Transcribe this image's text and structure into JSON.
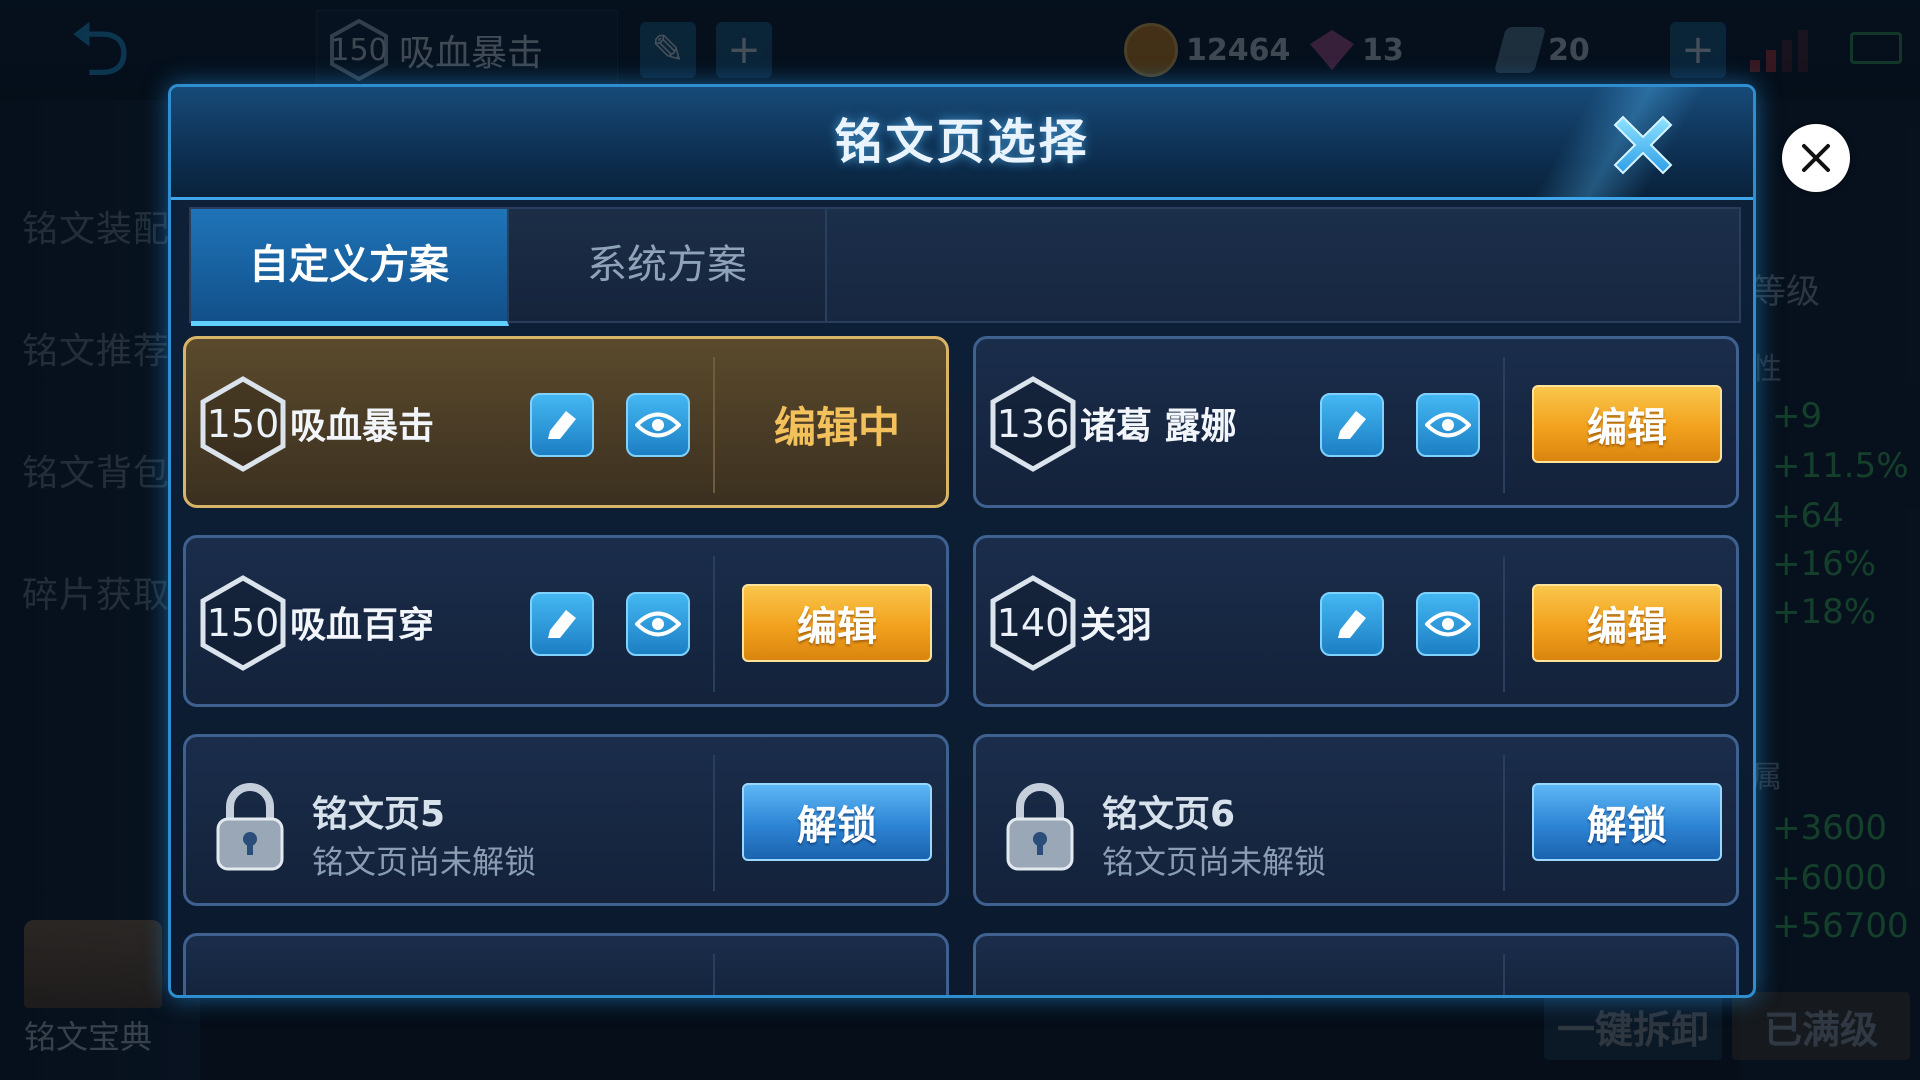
{
  "top_bar": {
    "back_icon": "back-arrow-icon",
    "current_page_level": "150",
    "current_page_name": "吸血暴击",
    "gold": "12464",
    "diamonds": "13",
    "tickets": "20"
  },
  "left_menu": {
    "items": [
      "铭文装配",
      "铭文推荐",
      "铭文背包",
      "碎片获取"
    ],
    "book_label": "铭文宝典"
  },
  "right_panel": {
    "level_label": "等级",
    "attr_label": "性",
    "stats": [
      "+9",
      "+11.5%",
      "+64",
      "+16%",
      "+18%"
    ],
    "belong_label": "属",
    "totals": [
      "+3600",
      "+6000",
      "+56700"
    ],
    "dismantle_all": "一键拆卸",
    "maxed": "已满级"
  },
  "dialog": {
    "title": "铭文页选择",
    "tabs": [
      {
        "label": "自定义方案",
        "active": true
      },
      {
        "label": "系统方案",
        "active": false
      }
    ],
    "pages": [
      {
        "level": "150",
        "name": "吸血暴击",
        "status": "编辑中",
        "selected": true
      },
      {
        "level": "136",
        "name": "诸葛 露娜",
        "action": "编辑"
      },
      {
        "level": "150",
        "name": "吸血百穿",
        "action": "编辑"
      },
      {
        "level": "140",
        "name": "关羽",
        "action": "编辑"
      },
      {
        "name": "铭文页5",
        "subtitle": "铭文页尚未解锁",
        "action": "解锁",
        "locked": true
      },
      {
        "name": "铭文页6",
        "subtitle": "铭文页尚未解锁",
        "action": "解锁",
        "locked": true
      }
    ]
  },
  "colors": {
    "accent_blue": "#2f8ed0",
    "edit_orange": "#f2a11d",
    "selected_gold": "#d8b469",
    "stat_green": "#3fc25c"
  }
}
